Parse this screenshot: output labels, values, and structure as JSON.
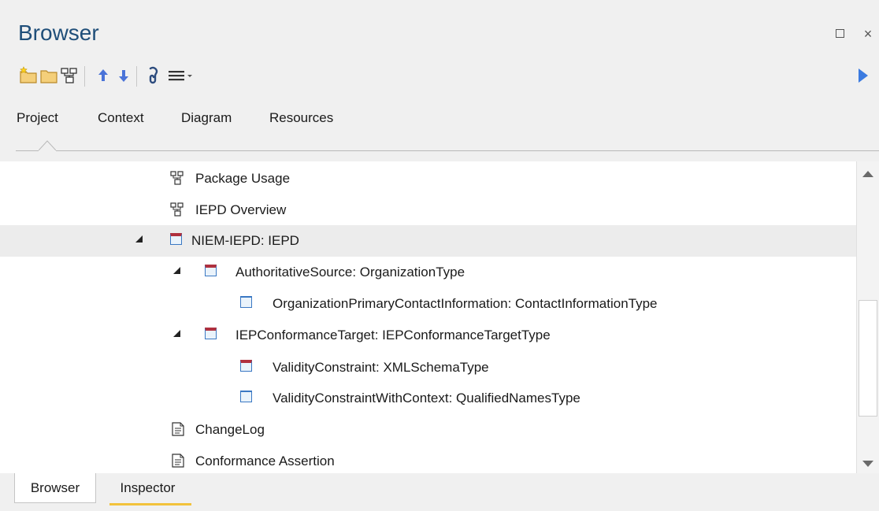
{
  "window": {
    "title": "Browser",
    "maximize_icon": "maximize-icon",
    "close_glyph": "×"
  },
  "toolbar": {
    "buttons": [
      {
        "name": "new-package-icon"
      },
      {
        "name": "folder-icon"
      },
      {
        "name": "new-diagram-icon"
      },
      {
        "name": "move-up-icon"
      },
      {
        "name": "move-down-icon"
      },
      {
        "name": "locate-icon"
      },
      {
        "name": "menu-icon"
      },
      {
        "name": "run-arrow-icon"
      }
    ]
  },
  "tabs": [
    {
      "label": "Project"
    },
    {
      "label": "Context"
    },
    {
      "label": "Diagram"
    },
    {
      "label": "Resources"
    }
  ],
  "active_tab": "Project",
  "tree": {
    "rows": [
      {
        "label": "Package Usage",
        "icon": "diagram-icon",
        "expanded": null,
        "selected": false
      },
      {
        "label": "IEPD Overview",
        "icon": "diagram-icon",
        "expanded": null,
        "selected": false
      },
      {
        "label": "NIEM-IEPD: IEPD",
        "icon": "element-icon-red",
        "expanded": true,
        "selected": true
      },
      {
        "label": "AuthoritativeSource: OrganizationType",
        "icon": "element-icon-red",
        "expanded": true,
        "selected": false
      },
      {
        "label": "OrganizationPrimaryContactInformation: ContactInformationType",
        "icon": "element-icon-blue",
        "expanded": null,
        "selected": false
      },
      {
        "label": "IEPConformanceTarget: IEPConformanceTargetType",
        "icon": "element-icon-red",
        "expanded": true,
        "selected": false
      },
      {
        "label": "ValidityConstraint: XMLSchemaType",
        "icon": "element-icon-red",
        "expanded": null,
        "selected": false
      },
      {
        "label": "ValidityConstraintWithContext: QualifiedNamesType",
        "icon": "element-icon-blue",
        "expanded": null,
        "selected": false
      },
      {
        "label": "ChangeLog",
        "icon": "document-icon",
        "expanded": null,
        "selected": false
      },
      {
        "label": "Conformance Assertion",
        "icon": "document-icon",
        "expanded": null,
        "selected": false
      }
    ]
  },
  "bottom_tabs": [
    {
      "label": "Browser"
    },
    {
      "label": "Inspector"
    }
  ],
  "active_bottom_tab": "Browser",
  "colors": {
    "title": "#1f4e79",
    "arrow_blue": "#4a73d8",
    "element_red": "#b0303e",
    "element_blue": "#3a78c3",
    "selected_row": "#ececec",
    "inspector_underline": "#f2c23b"
  }
}
